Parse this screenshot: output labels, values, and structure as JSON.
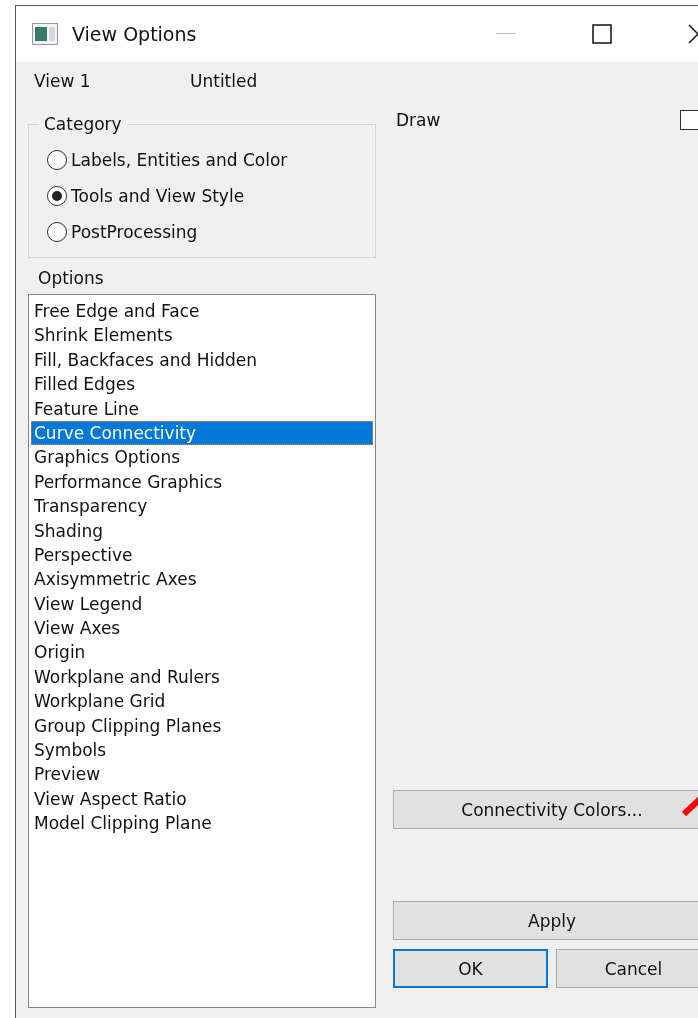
{
  "window": {
    "title": "View Options"
  },
  "view": {
    "label": "View  1",
    "name": "Untitled"
  },
  "category": {
    "title": "Category",
    "options": [
      {
        "label": "Labels, Entities and Color",
        "selected": false
      },
      {
        "label": "Tools and View Style",
        "selected": true
      },
      {
        "label": "PostProcessing",
        "selected": false
      }
    ]
  },
  "options": {
    "title": "Options",
    "items": [
      {
        "label": "Free Edge and Face",
        "selected": false
      },
      {
        "label": "Shrink Elements",
        "selected": false
      },
      {
        "label": "Fill, Backfaces and Hidden",
        "selected": false
      },
      {
        "label": "Filled Edges",
        "selected": false
      },
      {
        "label": "Feature Line",
        "selected": false
      },
      {
        "label": "Curve Connectivity",
        "selected": true
      },
      {
        "label": "Graphics Options",
        "selected": false
      },
      {
        "label": "Performance Graphics",
        "selected": false
      },
      {
        "label": "Transparency",
        "selected": false
      },
      {
        "label": "Shading",
        "selected": false
      },
      {
        "label": "Perspective",
        "selected": false
      },
      {
        "label": "Axisymmetric Axes",
        "selected": false
      },
      {
        "label": "View Legend",
        "selected": false
      },
      {
        "label": "View Axes",
        "selected": false
      },
      {
        "label": "Origin",
        "selected": false
      },
      {
        "label": "Workplane and Rulers",
        "selected": false
      },
      {
        "label": "Workplane Grid",
        "selected": false
      },
      {
        "label": "Group Clipping Planes",
        "selected": false
      },
      {
        "label": "Symbols",
        "selected": false
      },
      {
        "label": "Preview",
        "selected": false
      },
      {
        "label": "View Aspect Ratio",
        "selected": false
      },
      {
        "label": "Model Clipping Plane",
        "selected": false
      }
    ]
  },
  "draw": {
    "label": "Draw",
    "checked": false
  },
  "buttons": {
    "connectivity": "Connectivity Colors...",
    "apply": "Apply",
    "ok": "OK",
    "cancel": "Cancel"
  }
}
